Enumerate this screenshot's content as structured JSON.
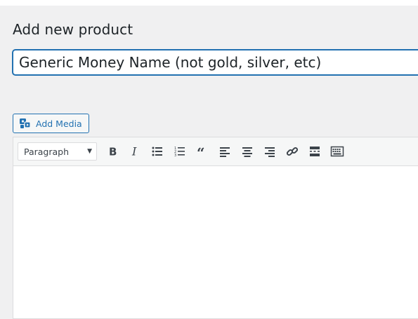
{
  "page": {
    "title": "Add new product"
  },
  "title_field": {
    "value": "Generic Money Name (not gold, silver, etc)"
  },
  "media": {
    "add_media_label": "Add Media",
    "icon": "add-media-icon"
  },
  "editor": {
    "format_select": {
      "selected": "Paragraph"
    },
    "toolbar_icons": [
      "bold",
      "italic",
      "bulleted-list",
      "numbered-list",
      "blockquote",
      "align-left",
      "align-center",
      "align-right",
      "insert-link",
      "read-more",
      "toolbar-toggle"
    ],
    "content": ""
  },
  "colors": {
    "accent": "#2271b1",
    "background": "#f0f0f1",
    "text": "#1d2327",
    "icon": "#3c434a"
  }
}
